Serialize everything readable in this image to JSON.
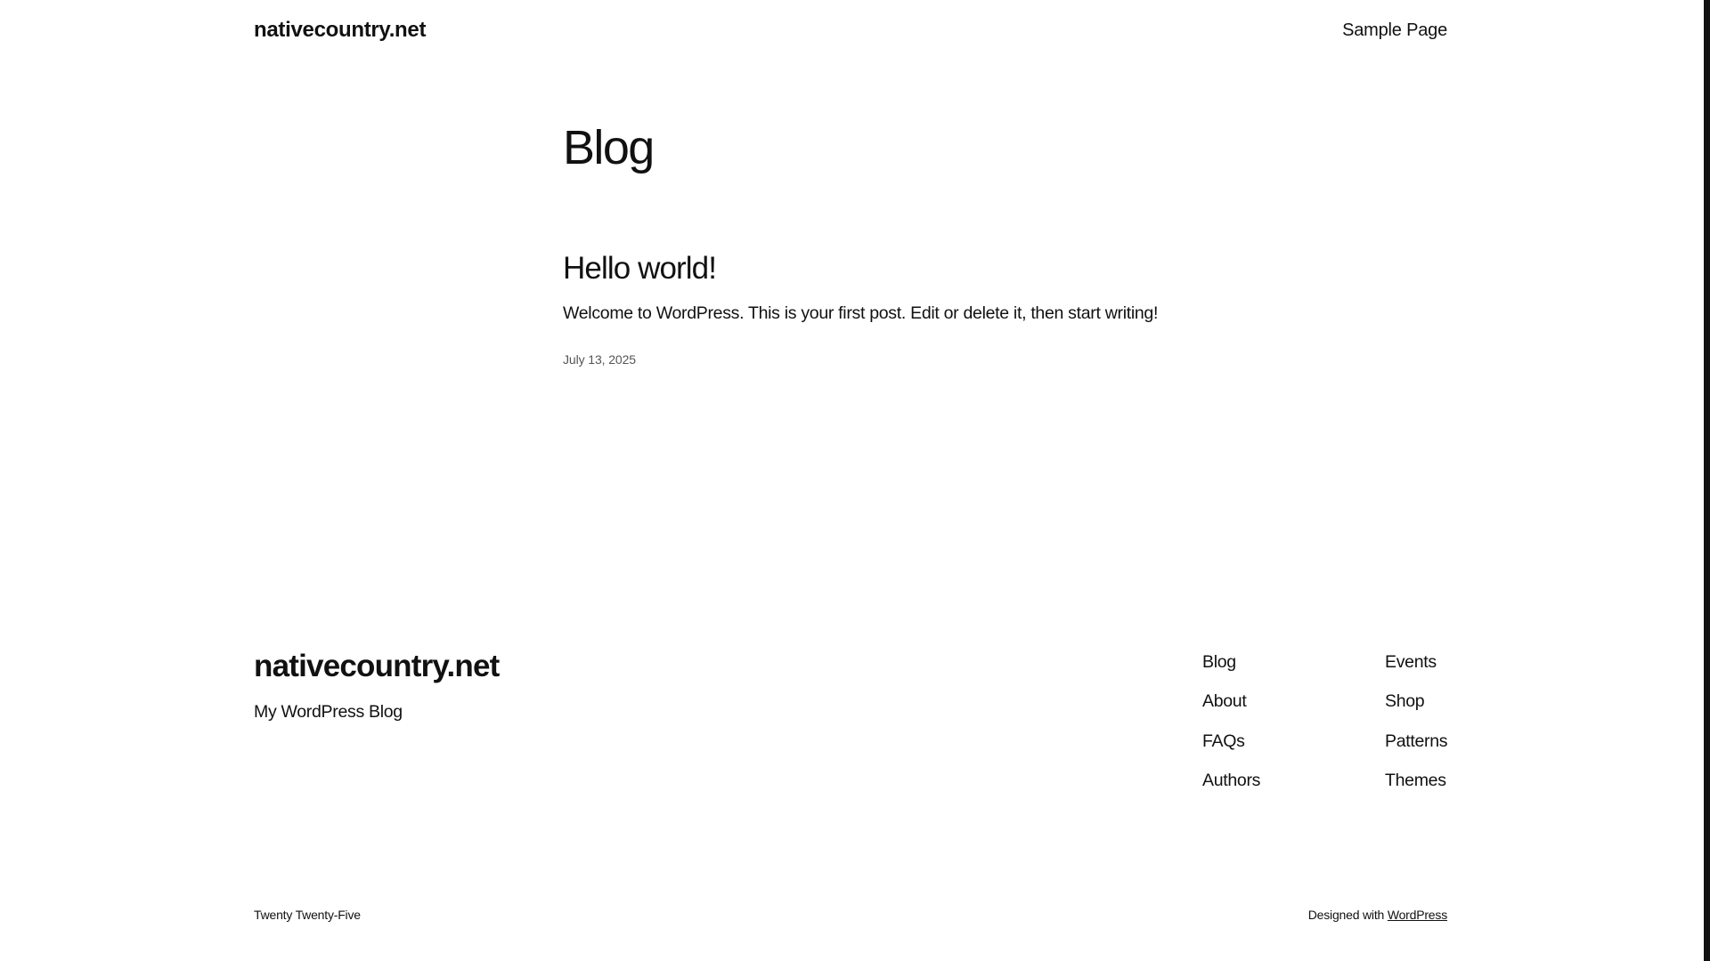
{
  "header": {
    "site_title": "nativecountry.net",
    "nav": [
      "Sample Page"
    ]
  },
  "main": {
    "page_heading": "Blog",
    "posts": [
      {
        "title": "Hello world!",
        "excerpt": "Welcome to WordPress. This is your first post. Edit or delete it, then start writing!",
        "date": "July 13, 2025"
      }
    ]
  },
  "footer": {
    "site_title": "nativecountry.net",
    "tagline": "My WordPress Blog",
    "nav_col_1": [
      "Blog",
      "About",
      "FAQs",
      "Authors"
    ],
    "nav_col_2": [
      "Events",
      "Shop",
      "Patterns",
      "Themes"
    ],
    "theme_credit": "Twenty Twenty-Five",
    "designed_with_label": "Designed with",
    "designed_with_link": "WordPress"
  },
  "colors": {
    "text": "#111111",
    "background": "#ffffff",
    "muted": "#555555"
  }
}
